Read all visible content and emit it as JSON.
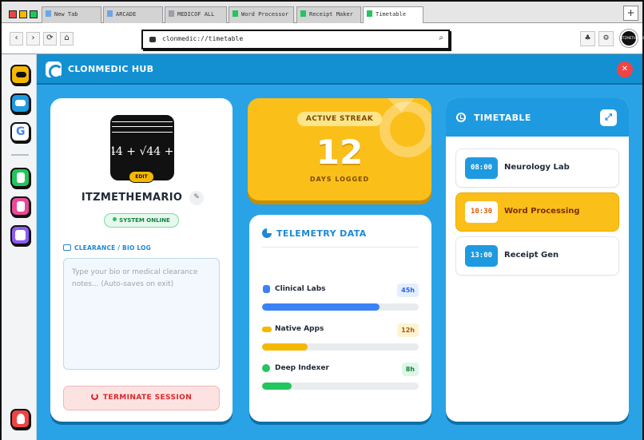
{
  "browser": {
    "tabs": [
      {
        "label": "New Tab",
        "favicon_color": "#6aa7e8",
        "active": false
      },
      {
        "label": "ARCADE",
        "favicon_color": "#6aa7e8",
        "active": false
      },
      {
        "label": "MEDICOF ALL",
        "favicon_color": "#9aa0a6",
        "active": false
      },
      {
        "label": "Word Processor",
        "favicon_color": "#22c55e",
        "active": false
      },
      {
        "label": "Receipt Maker",
        "favicon_color": "#22c55e",
        "active": false
      },
      {
        "label": "Timetable",
        "favicon_color": "#22c55e",
        "active": true
      }
    ],
    "new_tab_label": "+",
    "back_icon": "‹",
    "forward_icon": "›",
    "reload_icon": "⟳",
    "home_icon": "⌂",
    "url": "clonmedic://timetable",
    "search_icon": "⌕",
    "extensions_icon": "♣",
    "settings_icon": "⚙",
    "profile_text": "ITZMETHEMARIO"
  },
  "app": {
    "title": "CLONMEDIC HUB",
    "close_icon": "✕",
    "accent_color": "#1390d2",
    "dock": [
      {
        "name": "arcade",
        "color": "#f5b800",
        "glyph_color": "#111"
      },
      {
        "name": "academy",
        "color": "#1e9ae0",
        "glyph_color": "#fff"
      },
      {
        "name": "google",
        "color": "#ffffff",
        "glyph": "G"
      },
      {
        "name": "word-processor",
        "color": "#22c55e",
        "glyph_color": "#fff"
      },
      {
        "name": "documents",
        "color": "#ec4899",
        "glyph_color": "#fff"
      },
      {
        "name": "timetable",
        "color": "#8b5cf6",
        "glyph_color": "#fff"
      }
    ],
    "dock_logout_color": "#ef4444"
  },
  "profile": {
    "edit_label": "EDIT",
    "avatar_math": "44 + √44 +",
    "username": "ITZMETHEMARIO",
    "status": "SYSTEM ONLINE",
    "bio_label": "CLEARANCE / BIO LOG",
    "bio_placeholder": "Type your bio or medical clearance notes... (Auto-saves on exit)",
    "bio_value": "",
    "terminate_label": "TERMINATE SESSION"
  },
  "streak": {
    "label": "ACTIVE STREAK",
    "value": "12",
    "sublabel": "DAYS LOGGED"
  },
  "telemetry": {
    "title": "TELEMETRY DATA",
    "metrics": [
      {
        "label": "Clinical Labs",
        "value": "45h",
        "progress": 0.75,
        "color": "#3b82f6",
        "badge_bg": "#e3efff",
        "badge_fg": "#2563eb",
        "icon": "microscope-icon"
      },
      {
        "label": "Native Apps",
        "value": "12h",
        "progress": 0.29,
        "color": "#f5b800",
        "badge_bg": "#fdf3cf",
        "badge_fg": "#b45309",
        "icon": "gamepad-icon"
      },
      {
        "label": "Deep Indexer",
        "value": "8h",
        "progress": 0.19,
        "color": "#22c55e",
        "badge_bg": "#dcf7e6",
        "badge_fg": "#15803d",
        "icon": "bug-icon"
      }
    ]
  },
  "timetable": {
    "title": "TIMETABLE",
    "expand_icon": "⤢",
    "slots": [
      {
        "time": "08:00",
        "name": "Neurology Lab",
        "active": false
      },
      {
        "time": "10:30",
        "name": "Word Processing",
        "active": true
      },
      {
        "time": "13:00",
        "name": "Receipt Gen",
        "active": false
      }
    ]
  }
}
